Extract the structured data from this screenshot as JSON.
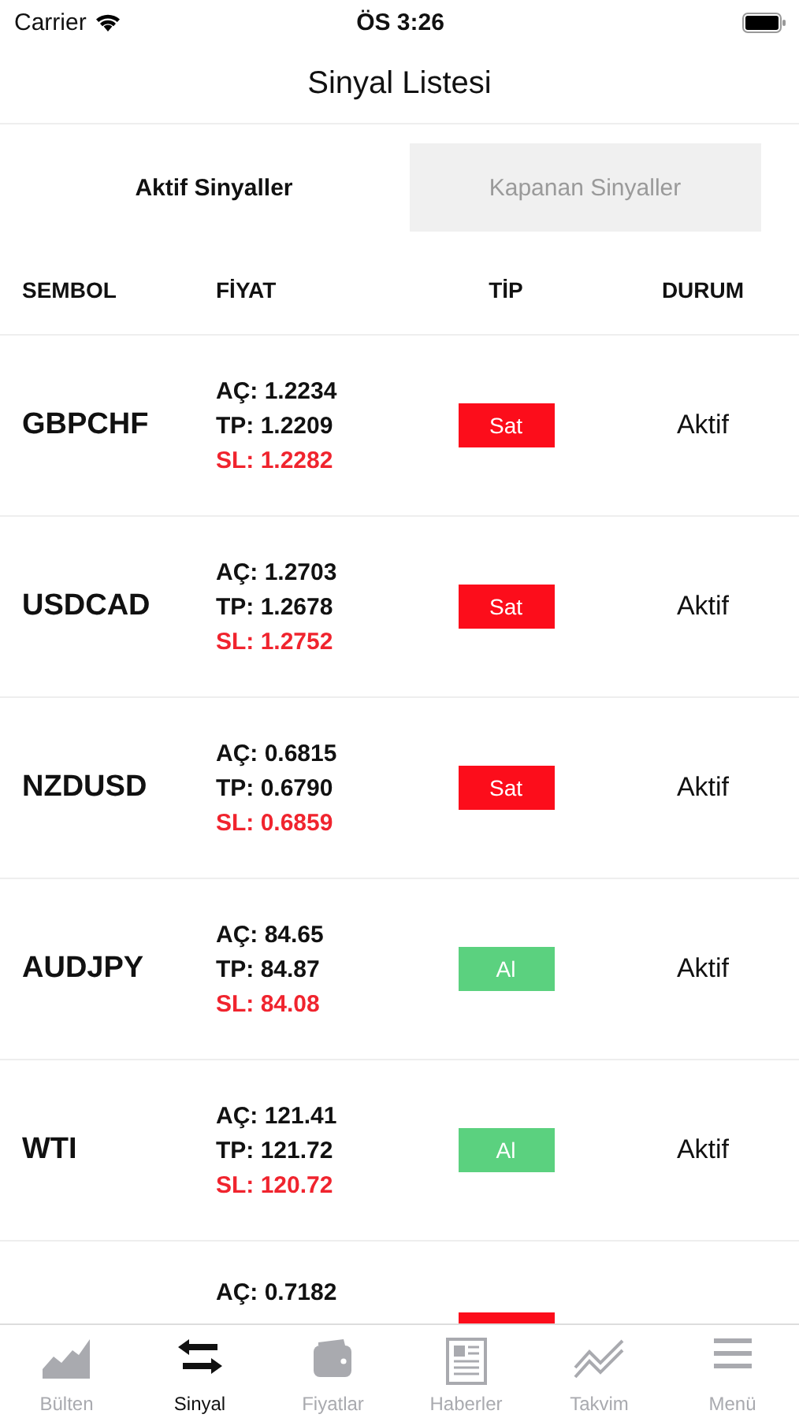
{
  "status_bar": {
    "carrier": "Carrier",
    "time": "ÖS 3:26"
  },
  "title": "Sinyal Listesi",
  "segments": [
    {
      "label": "Aktif Sinyaller",
      "selected": true
    },
    {
      "label": "Kapanan Sinyaller",
      "selected": false
    }
  ],
  "table": {
    "columns": [
      "SEMBOL",
      "FİYAT",
      "TİP",
      "DURUM"
    ],
    "rows": [
      {
        "symbol": "GBPCHF",
        "open": "AÇ: 1.2234",
        "tp": "TP: 1.2209",
        "sl": "SL: 1.2282",
        "type": {
          "kind": "sell",
          "label": "Sat"
        },
        "status": "Aktif"
      },
      {
        "symbol": "USDCAD",
        "open": "AÇ: 1.2703",
        "tp": "TP: 1.2678",
        "sl": "SL: 1.2752",
        "type": {
          "kind": "sell",
          "label": "Sat"
        },
        "status": "Aktif"
      },
      {
        "symbol": "NZDUSD",
        "open": "AÇ: 0.6815",
        "tp": "TP: 0.6790",
        "sl": "SL: 0.6859",
        "type": {
          "kind": "sell",
          "label": "Sat"
        },
        "status": "Aktif"
      },
      {
        "symbol": "AUDJPY",
        "open": "AÇ: 84.65",
        "tp": "TP: 84.87",
        "sl": "SL: 84.08",
        "type": {
          "kind": "buy",
          "label": "Al"
        },
        "status": "Aktif"
      },
      {
        "symbol": "WTI",
        "open": "AÇ: 121.41",
        "tp": "TP: 121.72",
        "sl": "SL: 120.72",
        "type": {
          "kind": "buy",
          "label": "Al"
        },
        "status": "Aktif"
      },
      {
        "open": "AÇ: 0.7182",
        "type": {
          "kind": "sell"
        }
      }
    ]
  },
  "tab_bar": [
    {
      "label": "Bülten",
      "kind": "area",
      "selected": false
    },
    {
      "label": "Sinyal",
      "kind": "arrows",
      "selected": true
    },
    {
      "label": "Fiyatlar",
      "kind": "wallet",
      "selected": false
    },
    {
      "label": "Haberler",
      "kind": "news",
      "selected": false
    },
    {
      "label": "Takvim",
      "kind": "line",
      "selected": false
    },
    {
      "label": "Menü",
      "kind": "menu",
      "selected": false
    }
  ]
}
